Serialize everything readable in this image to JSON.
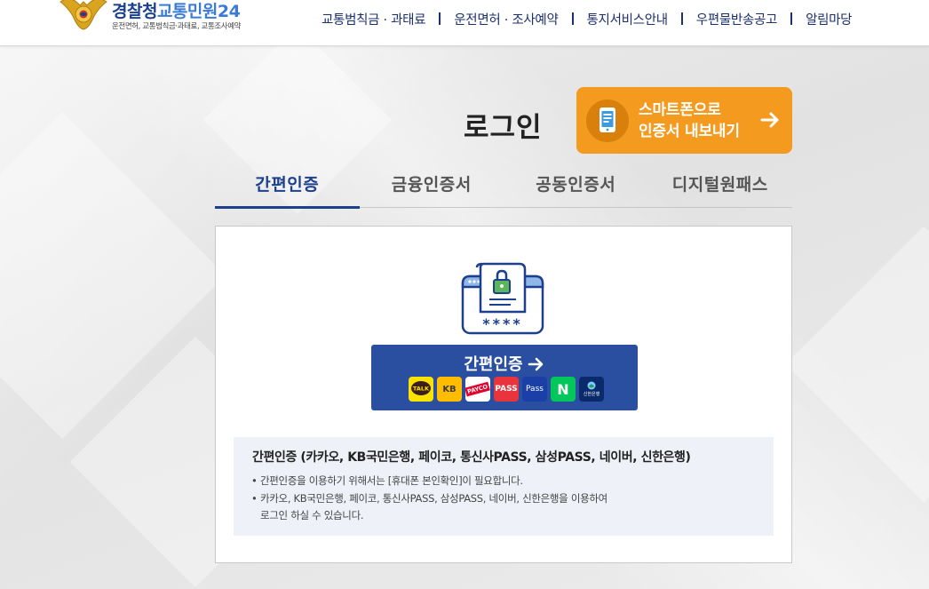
{
  "header": {
    "logo": {
      "brand": "경찰청",
      "service": "교통민원24",
      "subtitle": "운전면허, 교통범칙금·과태료, 교통조사예약"
    },
    "nav": [
      {
        "label": "교통범칙금 · 과태료"
      },
      {
        "label": "운전면허 · 조사예약"
      },
      {
        "label": "통지서비스안내"
      },
      {
        "label": "우편물반송공고"
      },
      {
        "label": "알림마당"
      }
    ]
  },
  "page": {
    "title": "로그인",
    "smartphone_button": {
      "line1": "스마트폰으로",
      "line2": "인증서 내보내기"
    }
  },
  "tabs": [
    {
      "label": "간편인증",
      "active": true
    },
    {
      "label": "금융인증서",
      "active": false
    },
    {
      "label": "공동인증서",
      "active": false
    },
    {
      "label": "디지털원패스",
      "active": false
    }
  ],
  "panel": {
    "illustration_text": "****",
    "auth_button": {
      "label": "간편인증"
    },
    "providers": [
      {
        "name": "kakao-talk",
        "label": "TALK",
        "bg": "#fae100",
        "fg": "#3b1e1e"
      },
      {
        "name": "kb-bank",
        "label": "KB",
        "bg": "#ffbc00",
        "fg": "#3a3a3a"
      },
      {
        "name": "payco",
        "label": "PAYCO",
        "bg": "#ffffff",
        "fg": "#e4002b"
      },
      {
        "name": "pass",
        "label": "PASS",
        "bg": "#e8343c",
        "fg": "#ffffff"
      },
      {
        "name": "samsung-pass",
        "label": "Pass",
        "bg": "#1a3fa6",
        "fg": "#ffffff"
      },
      {
        "name": "naver",
        "label": "N",
        "bg": "#03c75a",
        "fg": "#ffffff"
      },
      {
        "name": "shinhan",
        "label": "신한은행",
        "bg": "#0b2a6b",
        "fg": "#ffffff"
      }
    ],
    "info": {
      "title": "간편인증 (카카오, KB국민은행, 페이코, 통신사PASS, 삼성PASS, 네이버, 신한은행)",
      "items": [
        "간편인증을 이용하기 위해서는 [휴대폰 본인확인]이 필요합니다.",
        "카카오, KB국민은행, 페이코, 통신사PASS, 삼성PASS, 네이버, 신한은행을 이용하여"
      ],
      "continuation": "로그인 하실 수 있습니다."
    }
  },
  "colors": {
    "brand_navy": "#1c3f8e",
    "smart_orange": "#f39a1f",
    "auth_button_blue": "#2a4fa0",
    "info_bg": "#eef2f8"
  }
}
